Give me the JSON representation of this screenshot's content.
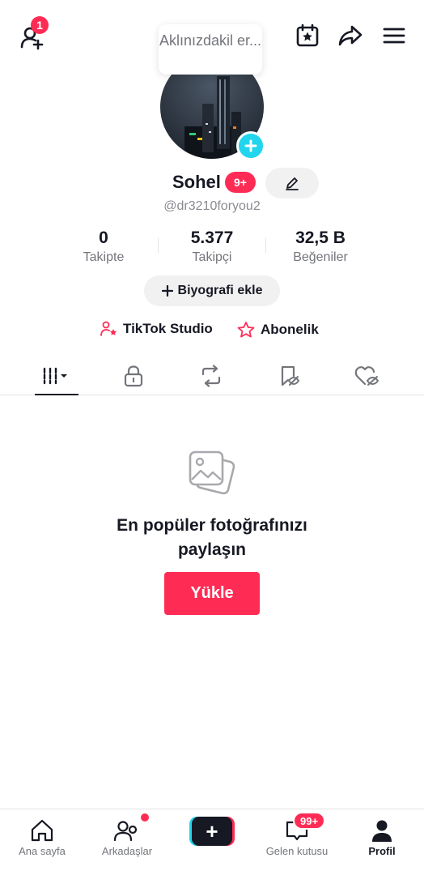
{
  "header": {
    "add_friend_badge": "1",
    "icons": [
      "add-friend-icon",
      "calendar-star-icon",
      "share-icon",
      "menu-icon"
    ]
  },
  "bubble": {
    "text": "Aklınızdakil er..."
  },
  "profile": {
    "username": "Sohel",
    "badge": "9+",
    "handle": "@dr3210foryou2"
  },
  "stats": [
    {
      "value": "0",
      "label": "Takipte"
    },
    {
      "value": "5.377",
      "label": "Takipçi"
    },
    {
      "value": "32,5 B",
      "label": "Beğeniler"
    }
  ],
  "bio_button": {
    "label": "Biyografi ekle",
    "icon": "plus-icon"
  },
  "links": {
    "studio": "TikTok Studio",
    "subscription": "Abonelik"
  },
  "tabs": [
    "videos-grid",
    "private-lock",
    "reposts",
    "favorites",
    "liked"
  ],
  "empty_state": {
    "title_line1": "En popüler fotoğrafınızı",
    "title_line2": "paylaşın",
    "upload_label": "Yükle"
  },
  "bottom_nav": {
    "home": "Ana sayfa",
    "friends": "Arkadaşlar",
    "create": "+",
    "inbox": "Gelen kutusu",
    "inbox_badge": "99+",
    "profile": "Profil"
  },
  "colors": {
    "accent": "#fe2c55",
    "cyan": "#20d5ec",
    "text": "#161823",
    "muted": "#73757b"
  }
}
